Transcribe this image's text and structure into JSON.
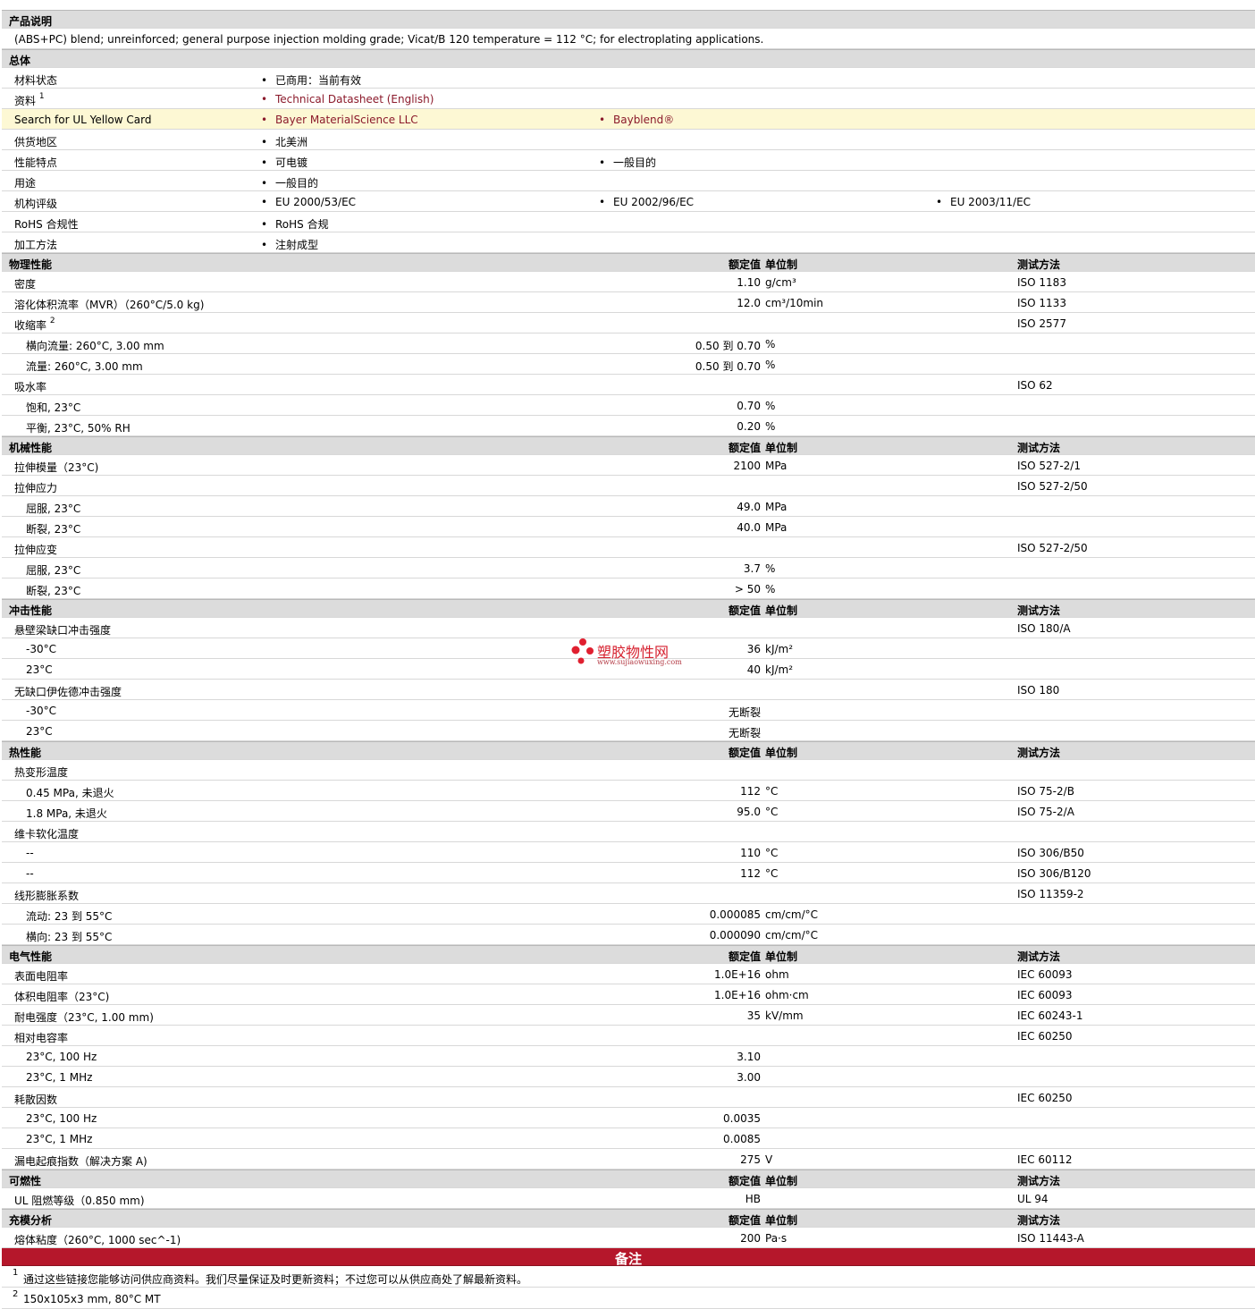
{
  "desc": {
    "header": "产品说明",
    "text": "(ABS+PC) blend; unreinforced; general purpose injection molding grade; Vicat/B 120 temperature = 112 °C; for electroplating applications."
  },
  "general": {
    "header": "总体",
    "rows": [
      {
        "label": "材料状态",
        "items": [
          "已商用：当前有效"
        ]
      },
      {
        "label": "资料",
        "sup": "1",
        "items": [
          "Technical Datasheet (English)"
        ],
        "link": true
      },
      {
        "label": "Search for UL Yellow Card",
        "items": [
          "Bayer MaterialScience LLC",
          "Bayblend®"
        ],
        "link": true,
        "highlight": true
      },
      {
        "label": "供货地区",
        "items": [
          "北美洲"
        ]
      },
      {
        "label": "性能特点",
        "items": [
          "可电镀",
          "一般目的"
        ]
      },
      {
        "label": "用途",
        "items": [
          "一般目的"
        ]
      },
      {
        "label": "机构评级",
        "items": [
          "EU 2000/53/EC",
          "EU 2002/96/EC",
          "EU 2003/11/EC"
        ]
      },
      {
        "label": "RoHS 合规性",
        "items": [
          "RoHS 合规"
        ]
      },
      {
        "label": "加工方法",
        "items": [
          "注射成型"
        ]
      }
    ]
  },
  "col_headers": {
    "value": "额定值",
    "unit": "单位制",
    "method": "测试方法"
  },
  "sections": [
    {
      "title": "物理性能",
      "rows": [
        {
          "label": "密度",
          "value": "1.10",
          "unit": "g/cm³",
          "method": "ISO 1183"
        },
        {
          "label": "溶化体积流率（MVR）（260°C/5.0 kg)",
          "value": "12.0",
          "unit": "cm³/10min",
          "method": "ISO 1133"
        },
        {
          "label": "收缩率",
          "sup": "2",
          "method": "ISO 2577"
        },
        {
          "label": "横向流量: 260°C, 3.00 mm",
          "sub": true,
          "value": "0.50 到  0.70",
          "unit": "%"
        },
        {
          "label": "流量: 260°C, 3.00 mm",
          "sub": true,
          "value": "0.50 到  0.70",
          "unit": "%"
        },
        {
          "label": "吸水率",
          "method": "ISO 62"
        },
        {
          "label": "饱和, 23°C",
          "sub": true,
          "value": "0.70",
          "unit": "%"
        },
        {
          "label": "平衡, 23°C, 50% RH",
          "sub": true,
          "value": "0.20",
          "unit": "%"
        }
      ]
    },
    {
      "title": "机械性能",
      "rows": [
        {
          "label": "拉伸模量（23°C)",
          "value": "2100",
          "unit": "MPa",
          "method": "ISO 527-2/1"
        },
        {
          "label": "拉伸应力",
          "method": "ISO 527-2/50"
        },
        {
          "label": "屈服, 23°C",
          "sub": true,
          "value": "49.0",
          "unit": "MPa"
        },
        {
          "label": "断裂, 23°C",
          "sub": true,
          "value": "40.0",
          "unit": "MPa"
        },
        {
          "label": "拉伸应变",
          "method": "ISO 527-2/50"
        },
        {
          "label": "屈服, 23°C",
          "sub": true,
          "value": "3.7",
          "unit": "%"
        },
        {
          "label": "断裂, 23°C",
          "sub": true,
          "value": "> 50",
          "unit": "%"
        }
      ]
    },
    {
      "title": "冲击性能",
      "rows": [
        {
          "label": "悬壁梁缺口冲击强度",
          "method": "ISO 180/A"
        },
        {
          "label": "-30°C",
          "sub": true,
          "value": "36",
          "unit": "kJ/m²"
        },
        {
          "label": "23°C",
          "sub": true,
          "value": "40",
          "unit": "kJ/m²"
        },
        {
          "label": "无缺口伊佐德冲击强度",
          "method": "ISO 180"
        },
        {
          "label": "-30°C",
          "sub": true,
          "value": "无断裂"
        },
        {
          "label": "23°C",
          "sub": true,
          "value": "无断裂"
        }
      ]
    },
    {
      "title": "热性能",
      "rows": [
        {
          "label": "热变形温度"
        },
        {
          "label": "0.45 MPa, 未退火",
          "sub": true,
          "value": "112",
          "unit": "°C",
          "method": "ISO 75-2/B"
        },
        {
          "label": "1.8 MPa, 未退火",
          "sub": true,
          "value": "95.0",
          "unit": "°C",
          "method": "ISO 75-2/A"
        },
        {
          "label": "维卡软化温度"
        },
        {
          "label": "--",
          "sub": true,
          "value": "110",
          "unit": "°C",
          "method": "ISO 306/B50"
        },
        {
          "label": "--",
          "sub": true,
          "value": "112",
          "unit": "°C",
          "method": "ISO 306/B120"
        },
        {
          "label": "线形膨胀系数",
          "method": "ISO 11359-2"
        },
        {
          "label": "流动: 23 到  55°C",
          "sub": true,
          "value": "0.000085",
          "unit": "cm/cm/°C"
        },
        {
          "label": "横向: 23 到  55°C",
          "sub": true,
          "value": "0.000090",
          "unit": "cm/cm/°C"
        }
      ]
    },
    {
      "title": "电气性能",
      "rows": [
        {
          "label": "表面电阻率",
          "value": "1.0E+16",
          "unit": "ohm",
          "method": "IEC 60093"
        },
        {
          "label": "体积电阻率（23°C)",
          "value": "1.0E+16",
          "unit": "ohm·cm",
          "method": "IEC 60093"
        },
        {
          "label": "耐电强度（23°C, 1.00 mm)",
          "value": "35",
          "unit": "kV/mm",
          "method": "IEC 60243-1"
        },
        {
          "label": "相对电容率",
          "method": "IEC 60250"
        },
        {
          "label": "23°C, 100 Hz",
          "sub": true,
          "value": "3.10"
        },
        {
          "label": "23°C, 1 MHz",
          "sub": true,
          "value": "3.00"
        },
        {
          "label": "耗散因数",
          "method": "IEC 60250"
        },
        {
          "label": "23°C, 100 Hz",
          "sub": true,
          "value": "0.0035"
        },
        {
          "label": "23°C, 1 MHz",
          "sub": true,
          "value": "0.0085"
        },
        {
          "label": "漏电起痕指数（解决方案  A)",
          "value": "275",
          "unit": "V",
          "method": "IEC 60112"
        }
      ]
    },
    {
      "title": "可燃性",
      "rows": [
        {
          "label": "UL 阻燃等级（0.850 mm)",
          "value": "HB",
          "method": "UL 94"
        }
      ]
    },
    {
      "title": "充模分析",
      "rows": [
        {
          "label": "熔体粘度（260°C, 1000 sec^-1)",
          "value": "200",
          "unit": "Pa·s",
          "method": "ISO 11443-A"
        }
      ]
    }
  ],
  "remarks": {
    "title": "备注",
    "notes": [
      {
        "n": "1",
        "text": "通过这些链接您能够访问供应商资料。我们尽量保证及时更新资料；不过您可以从供应商处了解最新资料。"
      },
      {
        "n": "2",
        "text": "150x105x3 mm, 80°C MT"
      }
    ]
  },
  "watermark": {
    "text": "塑胶物性网",
    "url": "www.sujiaowuxing.com"
  },
  "colors": {
    "section_bg": "#dcdcdc",
    "highlight_bg": "#fdf8d4",
    "link": "#8b1a2b",
    "remarks_bg": "#b5172b"
  }
}
